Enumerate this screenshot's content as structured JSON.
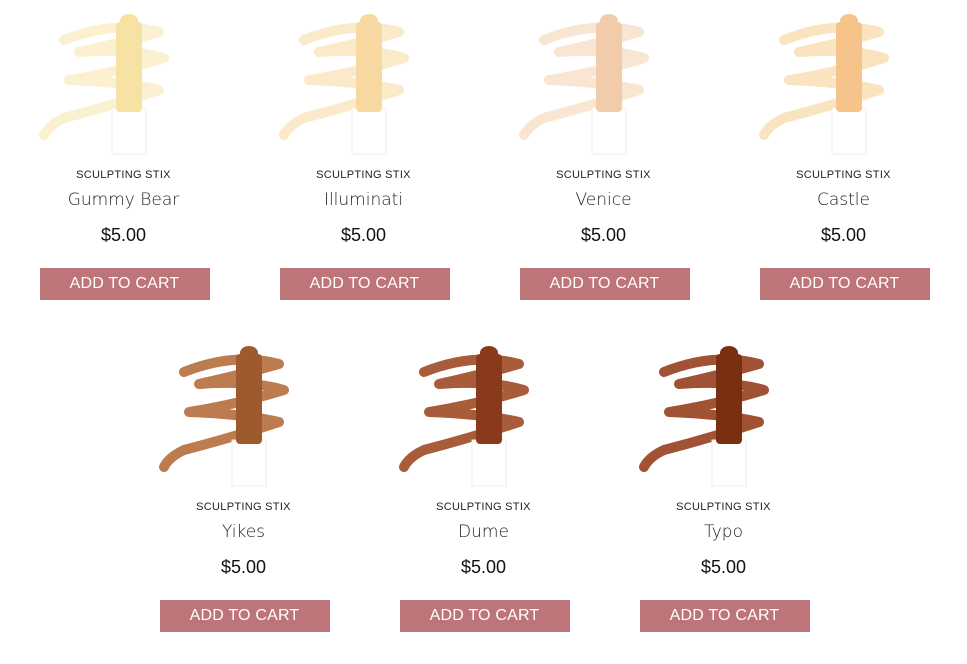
{
  "products": [
    {
      "brand": "SCULPTING STIX",
      "name": "Gummy Bear",
      "price": "$5.00",
      "button": "ADD TO CART",
      "shade": "#f6e2a2",
      "swatch": "#f9ecc0"
    },
    {
      "brand": "SCULPTING STIX",
      "name": "Illuminati",
      "price": "$5.00",
      "button": "ADD TO CART",
      "shade": "#f6d8a0",
      "swatch": "#f8e3b7"
    },
    {
      "brand": "SCULPTING STIX",
      "name": "Venice",
      "price": "$5.00",
      "button": "ADD TO CART",
      "shade": "#f2ccaa",
      "swatch": "#f5ddc4"
    },
    {
      "brand": "SCULPTING STIX",
      "name": "Castle",
      "price": "$5.00",
      "button": "ADD TO CART",
      "shade": "#f6c48a",
      "swatch": "#f8d9a9"
    },
    {
      "brand": "SCULPTING STIX",
      "name": "Yikes",
      "price": "$5.00",
      "button": "ADD TO CART",
      "shade": "#9e5a2e",
      "swatch": "#b56e3c"
    },
    {
      "brand": "SCULPTING STIX",
      "name": "Dume",
      "price": "$5.00",
      "button": "ADD TO CART",
      "shade": "#8a3a1c",
      "swatch": "#a04a24"
    },
    {
      "brand": "SCULPTING STIX",
      "name": "Typo",
      "price": "$5.00",
      "button": "ADD TO CART",
      "shade": "#7a2e12",
      "swatch": "#973e1e"
    }
  ]
}
